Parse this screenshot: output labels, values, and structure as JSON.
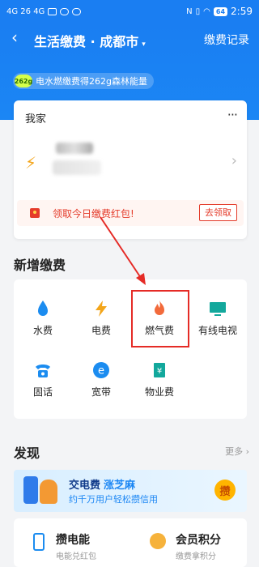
{
  "status_bar": {
    "left_text": "4G 26 4G",
    "time": "2:59",
    "battery": "64"
  },
  "nav": {
    "back_icon": "chevron-left-icon",
    "title": "生活缴费 · 成都市",
    "caret": "▾",
    "records": "缴费记录"
  },
  "energy": {
    "badge": "262g",
    "text": "电水燃缴费得262g森林能量"
  },
  "home": {
    "title": "我家",
    "more": "···",
    "promo_text": "领取今日缴费红包!",
    "promo_button": "去领取"
  },
  "new_payment": {
    "title": "新增缴费",
    "items": [
      {
        "label": "水费",
        "icon": "water-drop-icon"
      },
      {
        "label": "电费",
        "icon": "lightning-icon"
      },
      {
        "label": "燃气费",
        "icon": "flame-icon"
      },
      {
        "label": "有线电视",
        "icon": "tv-icon"
      },
      {
        "label": "固话",
        "icon": "telephone-icon"
      },
      {
        "label": "宽带",
        "icon": "broadband-icon"
      },
      {
        "label": "物业费",
        "icon": "property-icon"
      }
    ]
  },
  "discover": {
    "title": "发现",
    "more": "更多",
    "banner": {
      "title": "交电费",
      "highlight": "涨芝麻",
      "sub": "约千万用户轻松攒信用",
      "button": "攒"
    },
    "items": [
      {
        "title": "攒电能",
        "sub": "电能兑红包"
      },
      {
        "title": "会员积分",
        "sub": "缴费拿积分"
      }
    ]
  },
  "colors": {
    "brand": "#1a7ef2",
    "highlight": "#e52b26",
    "promo": "#e43b2a"
  }
}
